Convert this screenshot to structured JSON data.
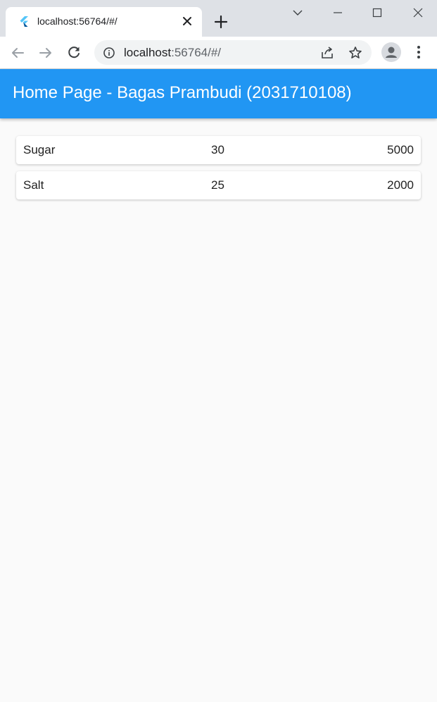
{
  "browser": {
    "tab": {
      "title": "localhost:56764/#/",
      "favicon": "flutter-icon"
    },
    "new_tab_icon": "plus-icon",
    "window_controls": [
      "chevron-down-icon",
      "minimize-icon",
      "maximize-icon",
      "close-icon"
    ],
    "nav": {
      "back_icon": "arrow-left-icon",
      "forward_icon": "arrow-right-icon",
      "reload_icon": "reload-icon"
    },
    "address_bar": {
      "host": "localhost",
      "rest": ":56764/#/"
    },
    "omnibox_icons": [
      "info-icon",
      "share-icon",
      "star-icon"
    ],
    "profile_icon": "person-icon",
    "menu_icon": "kebab-menu-icon"
  },
  "app": {
    "title": "Home Page - Bagas Prambudi (2031710108)",
    "colors": {
      "primary": "#2196f3",
      "background": "#fafafa"
    },
    "items": [
      {
        "name": "Sugar",
        "quantity": "30",
        "price": "5000"
      },
      {
        "name": "Salt",
        "quantity": "25",
        "price": "2000"
      }
    ]
  }
}
